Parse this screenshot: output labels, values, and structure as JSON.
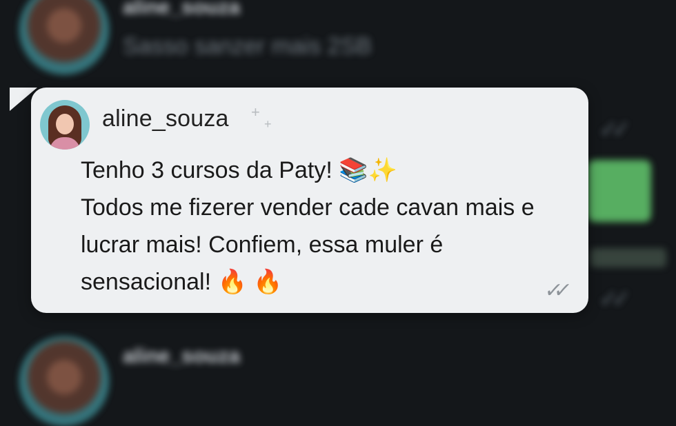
{
  "post": {
    "username": "aline_souza",
    "message_lines": [
      "Tenho 3 cursos da Paty! 📚✨",
      "Todos me fizerer vender cade cavan mais e",
      "lucrar mais! Confiem, essa muler é",
      "sensacional! 🔥 🔥"
    ]
  },
  "background": {
    "top_name": "aline_souza",
    "top_text": "Sasso sanzer mais 2SB",
    "bottom_name": "aline_souza"
  },
  "icons": {
    "sparkle": "sparkle-icon",
    "read_receipt": "double-check-icon"
  },
  "colors": {
    "page_bg": "#14171a",
    "bubble_bg": "#eef0f2",
    "accent_green": "#5fc06a"
  }
}
